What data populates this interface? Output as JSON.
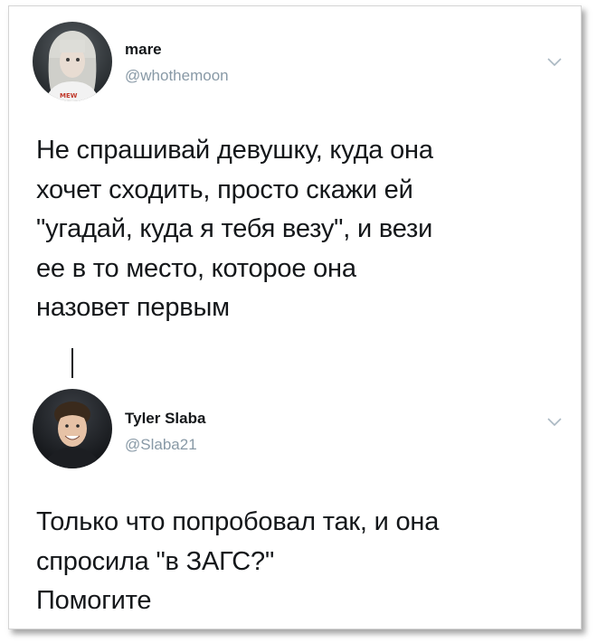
{
  "tweets": [
    {
      "display_name": "mare",
      "handle": "@whothemoon",
      "text": "Не спрашивай девушку, куда она\nхочет сходить, просто скажи ей\n\"угадай, куда я тебя везу\", и вези\nее в то место, которое она\nназовет первым",
      "avatar_icon": "profile-photo-girl-icon",
      "menu_icon": "chevron-down-icon"
    },
    {
      "display_name": "Tyler Slaba",
      "handle": "@Slaba21",
      "text": "Только что попробовал так, и она\nспросила \"в ЗАГС?\"\nПомогите",
      "avatar_icon": "profile-photo-guy-icon",
      "menu_icon": "chevron-down-icon"
    }
  ],
  "colors": {
    "text": "#14171a",
    "handle": "#8899a6",
    "chevron": "#aab8c2"
  }
}
